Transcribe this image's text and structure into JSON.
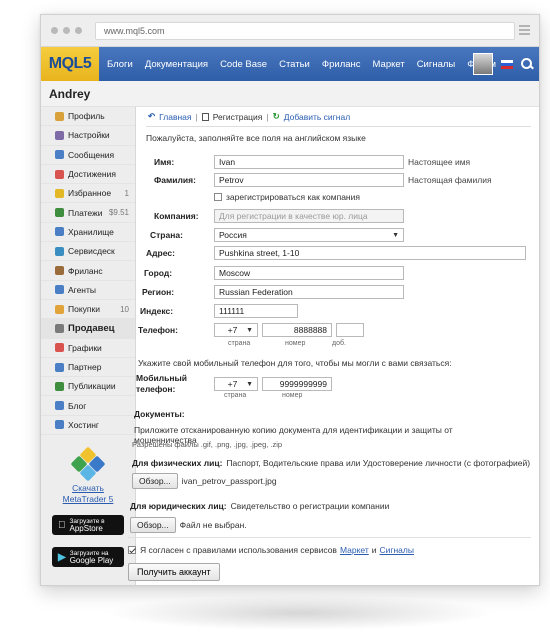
{
  "browser": {
    "url": "www.mql5.com"
  },
  "header": {
    "logo": "MQL5",
    "nav": [
      "Блоги",
      "Документация",
      "Code Base",
      "Статьи",
      "Фриланс",
      "Маркет",
      "Сигналы",
      "Форум"
    ]
  },
  "user": {
    "name": "Andrey"
  },
  "sidebar": {
    "items": [
      {
        "label": "Профиль",
        "count": "",
        "icon": "user-icon",
        "color": "#d9a13a"
      },
      {
        "label": "Настройки",
        "count": "",
        "icon": "settings-icon",
        "color": "#7d6aa6"
      },
      {
        "label": "Сообщения",
        "count": "",
        "icon": "messages-icon",
        "color": "#4a7fc6"
      },
      {
        "label": "Достижения",
        "count": "",
        "icon": "achievements-icon",
        "color": "#d9534f"
      },
      {
        "label": "Избранное",
        "count": "1",
        "icon": "favorites-icon",
        "color": "#e3b826"
      },
      {
        "label": "Платежи",
        "count": "$9.51",
        "icon": "payments-icon",
        "color": "#3f8e3f"
      },
      {
        "label": "Хранилище",
        "count": "",
        "icon": "storage-icon",
        "color": "#4a7fc6"
      },
      {
        "label": "Сервисдеск",
        "count": "",
        "icon": "servicedesk-icon",
        "color": "#3b8ec2"
      },
      {
        "label": "Фриланс",
        "count": "",
        "icon": "freelance-icon",
        "color": "#9a6b3b"
      },
      {
        "label": "Агенты",
        "count": "",
        "icon": "agents-icon",
        "color": "#4a7fc6"
      },
      {
        "label": "Покупки",
        "count": "10",
        "icon": "purchases-icon",
        "color": "#e0a43b"
      },
      {
        "label": "Продавец",
        "count": "",
        "icon": "seller-icon",
        "color": "#7a7a7a"
      },
      {
        "label": "Графики",
        "count": "",
        "icon": "charts-icon",
        "color": "#d9534f"
      },
      {
        "label": "Партнер",
        "count": "",
        "icon": "partner-icon",
        "color": "#4a7fc6"
      },
      {
        "label": "Публикации",
        "count": "",
        "icon": "publications-icon",
        "color": "#3f8e3f"
      },
      {
        "label": "Блог",
        "count": "",
        "icon": "blog-icon",
        "color": "#4a7fc6"
      },
      {
        "label": "Хостинг",
        "count": "",
        "icon": "hosting-icon",
        "color": "#4a7fc6"
      }
    ],
    "promo": {
      "line1": "Скачать",
      "line2": "MetaTrader 5"
    },
    "appstore": {
      "small": "Загрузите в",
      "big": "AppStore"
    },
    "googleplay": {
      "small": "Загрузите на",
      "big": "Google Play"
    }
  },
  "breadcrumb": {
    "home": "Главная",
    "separator": "|",
    "current": "Регистрация",
    "add": "Добавить сигнал"
  },
  "form": {
    "intro": "Пожалуйста, заполняйте все поля на английском языке",
    "first_name": {
      "label": "Имя:",
      "value": "Ivan",
      "hint": "Настоящее имя"
    },
    "last_name": {
      "label": "Фамилия:",
      "value": "Petrov",
      "hint": "Настоящая фамилия"
    },
    "company_check": {
      "label": "зарегистрироваться как компания"
    },
    "company": {
      "label": "Компания:",
      "placeholder": "Для регистрации в качестве юр. лица"
    },
    "country": {
      "label": "Страна:",
      "value": "Россия"
    },
    "address": {
      "label": "Адрес:",
      "value": "Pushkina street, 1-10"
    },
    "city": {
      "label": "Город:",
      "value": "Moscow"
    },
    "region": {
      "label": "Регион:",
      "value": "Russian Federation"
    },
    "zip": {
      "label": "Индекс:",
      "value": "111111"
    },
    "phone": {
      "label": "Телефон:",
      "country_code": "+7",
      "number": "8888888",
      "ext": "",
      "sub_country": "страна",
      "sub_number": "номер",
      "sub_ext": "доб."
    },
    "mobile_prompt": "Укажите свой мобильный телефон для того, чтобы мы могли с вами связаться:",
    "mobile": {
      "label1": "Мобильный",
      "label2": "телефон:",
      "country_code": "+7",
      "number": "9999999999",
      "sub_country": "страна",
      "sub_number": "номер"
    },
    "documents": {
      "title": "Документы:",
      "description": "Приложите отсканированную копию документа для идентификации и защиты от мошенничества",
      "allowed": "Разрешены файлы .gif, .png, .jpg, .jpeg, .zip",
      "individual_title": "Для физических лиц:",
      "individual_desc": "Паспорт, Водительские права или Удостоверение личности (с фотографией)",
      "browse1": "Обзор...",
      "file1": "ivan_petrov_passport.jpg",
      "legal_title": "Для юридических лиц:",
      "legal_desc": "Свидетельство о регистрации компании",
      "browse2": "Обзор...",
      "file2": "Файл не выбран."
    },
    "agree": {
      "prefix": "Я согласен с правилами использования сервисов",
      "market": "Маркет",
      "and": "и",
      "signals": "Сигналы"
    },
    "submit": "Получить аккаунт"
  }
}
